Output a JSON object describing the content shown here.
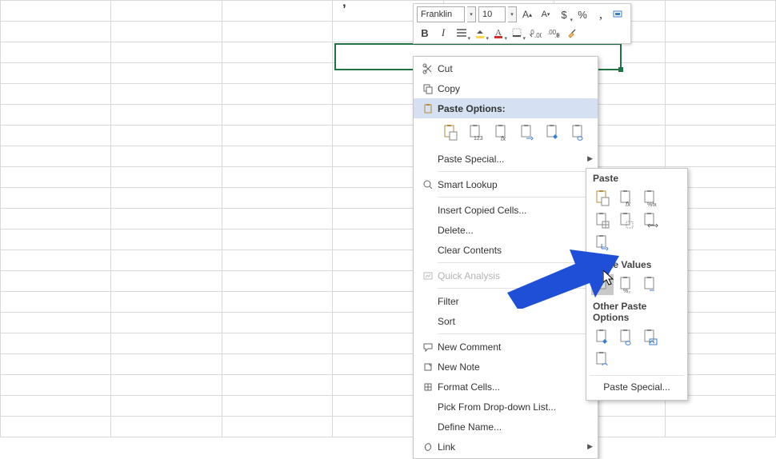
{
  "toolbar": {
    "font_name": "Franklin",
    "font_size": "10",
    "increase_font": "A▴",
    "decrease_font": "A▾",
    "currency_glyph": "$",
    "percent_glyph": "%",
    "comma_glyph": ",",
    "bold_glyph": "B",
    "italic_glyph": "I"
  },
  "sheet": {
    "apostrophe": "’"
  },
  "ctx": {
    "cut": "Cut",
    "copy": "Copy",
    "paste_options": "Paste Options:",
    "paste_special": "Paste Special...",
    "smart_lookup": "Smart Lookup",
    "insert_copied": "Insert Copied Cells...",
    "delete": "Delete...",
    "clear_contents": "Clear Contents",
    "quick_analysis": "Quick Analysis",
    "filter": "Filter",
    "sort": "Sort",
    "new_comment": "New Comment",
    "new_note": "New Note",
    "format_cells": "Format Cells...",
    "pick_from_list": "Pick From Drop-down List...",
    "define_name": "Define Name...",
    "link": "Link"
  },
  "sub": {
    "paste": "Paste",
    "paste_values": "Paste Values",
    "other_paste": "Other Paste Options",
    "paste_special": "Paste Special..."
  }
}
